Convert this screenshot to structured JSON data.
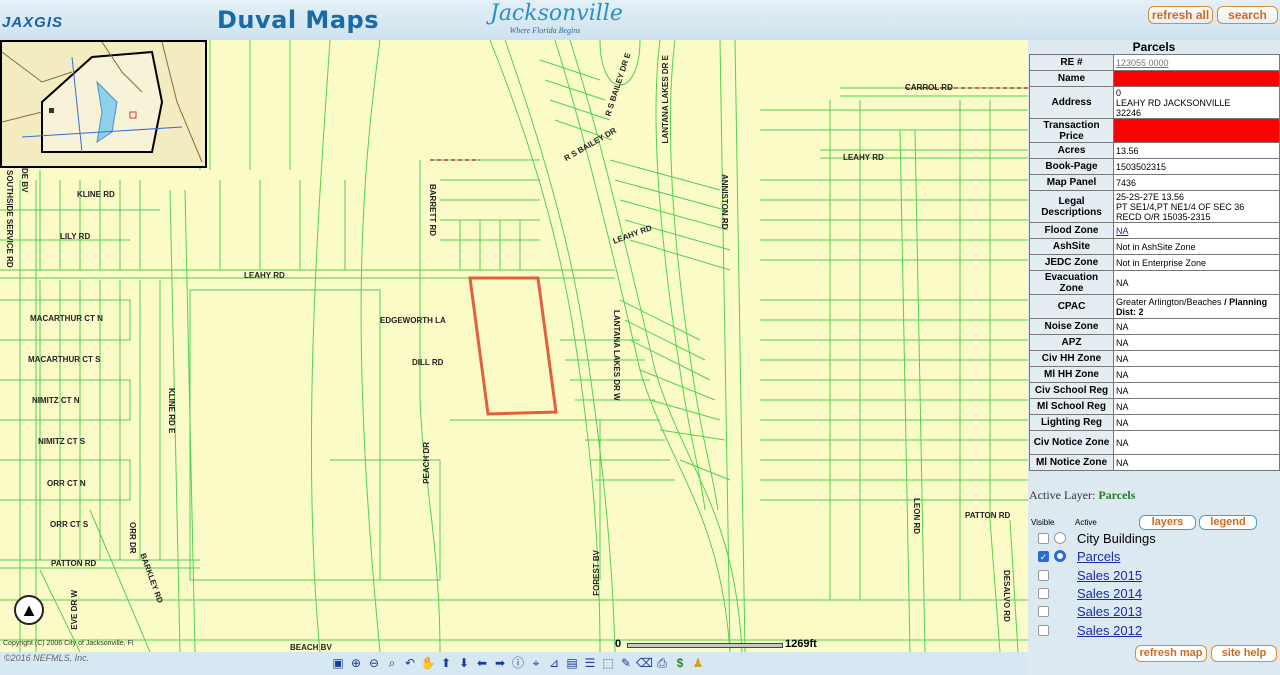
{
  "header": {
    "logo_text": "JAXGIS",
    "app_title": "Duval Maps",
    "city_name": "Jacksonville",
    "city_tagline": "Where Florida Begins",
    "refresh_all": "refresh all",
    "search": "search"
  },
  "map": {
    "roads": {
      "carrol": "CARROL RD",
      "leahy_e": "LEAHY RD",
      "kline": "KLINE RD",
      "lily": "LILY RD",
      "leahy_w": "LEAHY RD",
      "leahy_mid": "LEAHY RD",
      "macarthur_n": "MACARTHUR CT N",
      "macarthur_s": "MACARTHUR CT S",
      "nimitz_n": "NIMITZ CT N",
      "nimitz_s": "NIMITZ CT S",
      "orr_n": "ORR CT N",
      "orr_s": "ORR CT S",
      "patton_w": "PATTON RD",
      "patton_e": "PATTON RD",
      "edgeworth": "EDGEWORTH LA",
      "dill": "DILL RD",
      "beach": "BEACH BV",
      "rs_bailey_dr": "R S BAILEY DR",
      "rs_bailey_dr_e": "R S BAILEY DR E",
      "barrett": "BARRETT RD",
      "lantana_e": "LANTANA LAKES DR E",
      "lantana_w": "LANTANA LAKES DR W",
      "anniston": "ANNISTON RD",
      "leon": "LEON RD",
      "desalvo": "DESALVO RD",
      "forest": "FOREST BV",
      "peach": "PEACH DR",
      "kline_e": "KLINE RD E",
      "service": "SOUTHSIDE SERVICE RD",
      "orr_dr": "ORR DR",
      "barkley": "BARKLEY RD",
      "eve": "EVE DR W",
      "de_bv": "DE BV"
    },
    "scale_zero": "0",
    "scale_end": "1269ft",
    "copyright": "Copyright (C) 2006 City of Jacksonville, Fl",
    "mls": "©2016 NEFMLS, Inc."
  },
  "panel": {
    "heading": "Parcels",
    "rows": [
      {
        "label": "RE #",
        "value": "123055 0000"
      },
      {
        "label": "Name",
        "value": ""
      },
      {
        "label": "Address",
        "value": "0\nLEAHY RD   JACKSONVILLE\n32246"
      },
      {
        "label": "Transaction Price",
        "value": ""
      },
      {
        "label": "Acres",
        "value": "13.56"
      },
      {
        "label": "Book-Page",
        "value": "1503502315"
      },
      {
        "label": "Map Panel",
        "value": "7436"
      },
      {
        "label": "Legal Descriptions",
        "value": "25-2S-27E          13.56\nPT SE1/4,PT NE1/4 OF SEC 36\nRECD O/R 15035-2315"
      },
      {
        "label": "Flood Zone",
        "value": "NA"
      },
      {
        "label": "AshSite",
        "value": "Not in AshSite Zone"
      },
      {
        "label": "JEDC Zone",
        "value": "Not in Enterprise Zone"
      },
      {
        "label": "Evacuation Zone",
        "value": "NA"
      },
      {
        "label": "CPAC",
        "value": "Greater Arlington/Beaches"
      },
      {
        "label": "Noise Zone",
        "value": "NA"
      },
      {
        "label": "APZ",
        "value": "NA"
      },
      {
        "label": "Civ HH Zone",
        "value": "NA"
      },
      {
        "label": "Ml HH Zone",
        "value": "NA"
      },
      {
        "label": "Civ School Reg",
        "value": "NA"
      },
      {
        "label": "Ml School Reg",
        "value": "NA"
      },
      {
        "label": "Lighting Reg",
        "value": "NA"
      },
      {
        "label": "Civ Notice Zone",
        "value": "NA"
      },
      {
        "label": "Ml Notice Zone",
        "value": "NA"
      }
    ],
    "cpac_extra": " / Planning Dist:  2",
    "active_layer_label": "Active Layer:",
    "active_layer_name": "Parcels",
    "col_visible": "Visible",
    "col_active": "Active",
    "layers_btn": "layers",
    "legend_btn": "legend",
    "layers": [
      {
        "name": "City Buildings",
        "visible": false,
        "active": false
      },
      {
        "name": "Parcels",
        "visible": true,
        "active": true
      },
      {
        "name": "Sales 2015",
        "visible": false,
        "active": null
      },
      {
        "name": "Sales 2014",
        "visible": false,
        "active": null
      },
      {
        "name": "Sales 2013",
        "visible": false,
        "active": null
      },
      {
        "name": "Sales 2012",
        "visible": false,
        "active": null
      }
    ],
    "refresh_map": "refresh map",
    "site_help": "site help"
  },
  "toolbar": {
    "tools": [
      "full-extent",
      "zoom-in",
      "zoom-out",
      "zoom-box",
      "back",
      "pan",
      "pan-north",
      "pan-south",
      "pan-west",
      "pan-east",
      "identify",
      "select",
      "measure",
      "print-area",
      "list",
      "select-area",
      "find",
      "erase",
      "print",
      "dollar",
      "streetview"
    ]
  },
  "colors": {
    "map_bg": "#fbfbc8",
    "parcel_line": "#3ccc3c",
    "selected_parcel": "#e0603a",
    "name_redacted": "#ff0000"
  }
}
